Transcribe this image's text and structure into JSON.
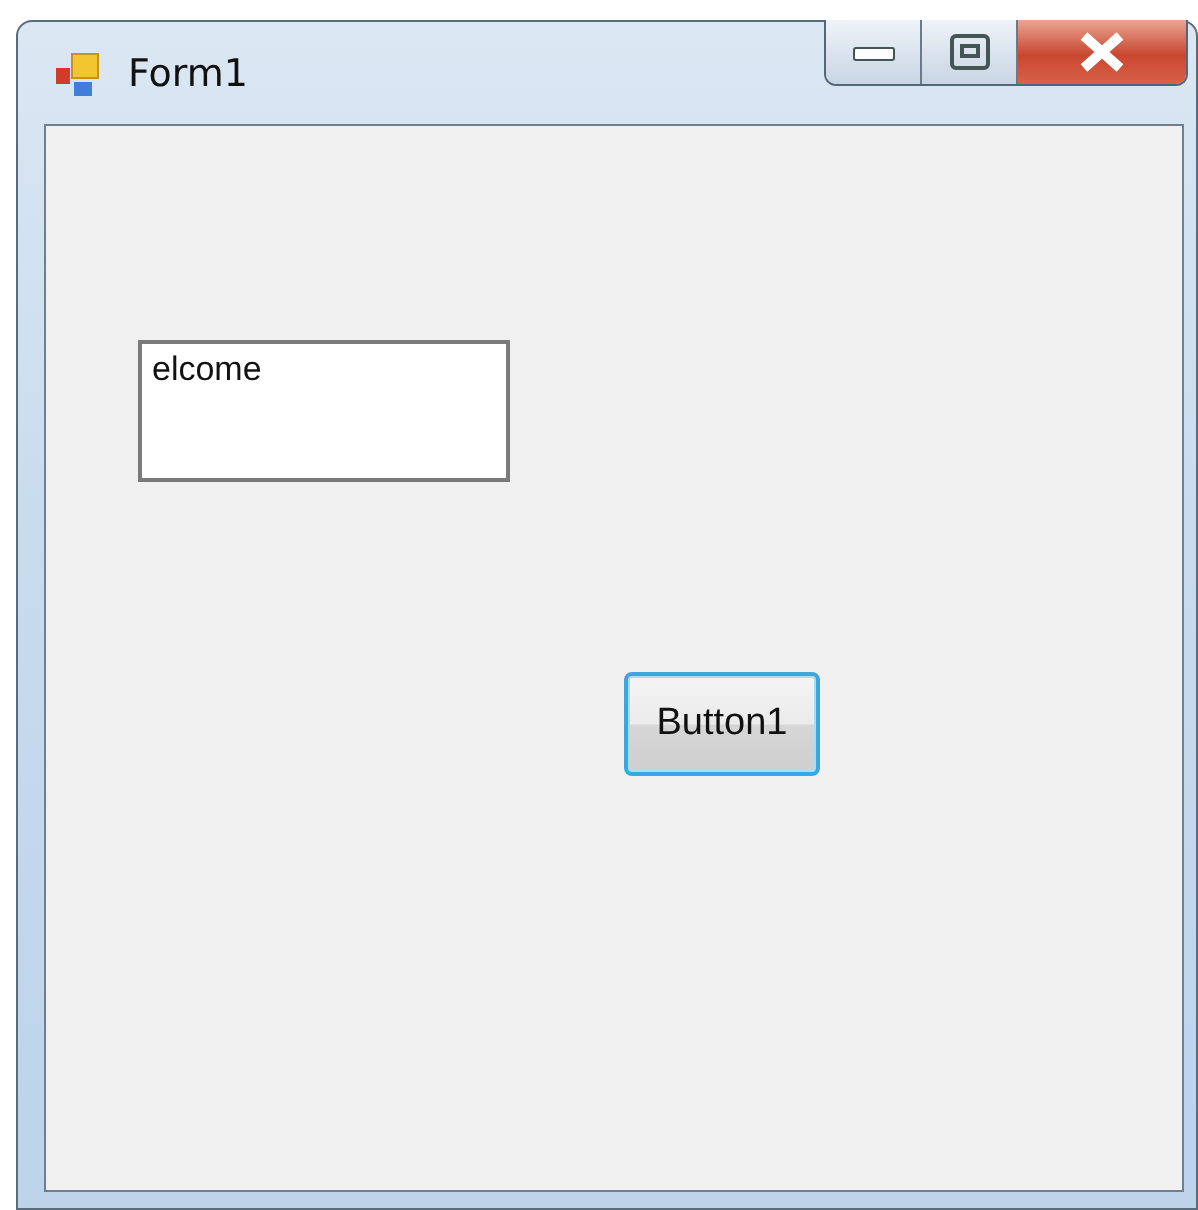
{
  "window": {
    "title": "Form1"
  },
  "text_box": {
    "value": "elcome"
  },
  "button": {
    "label": "Button1",
    "focused": true
  }
}
